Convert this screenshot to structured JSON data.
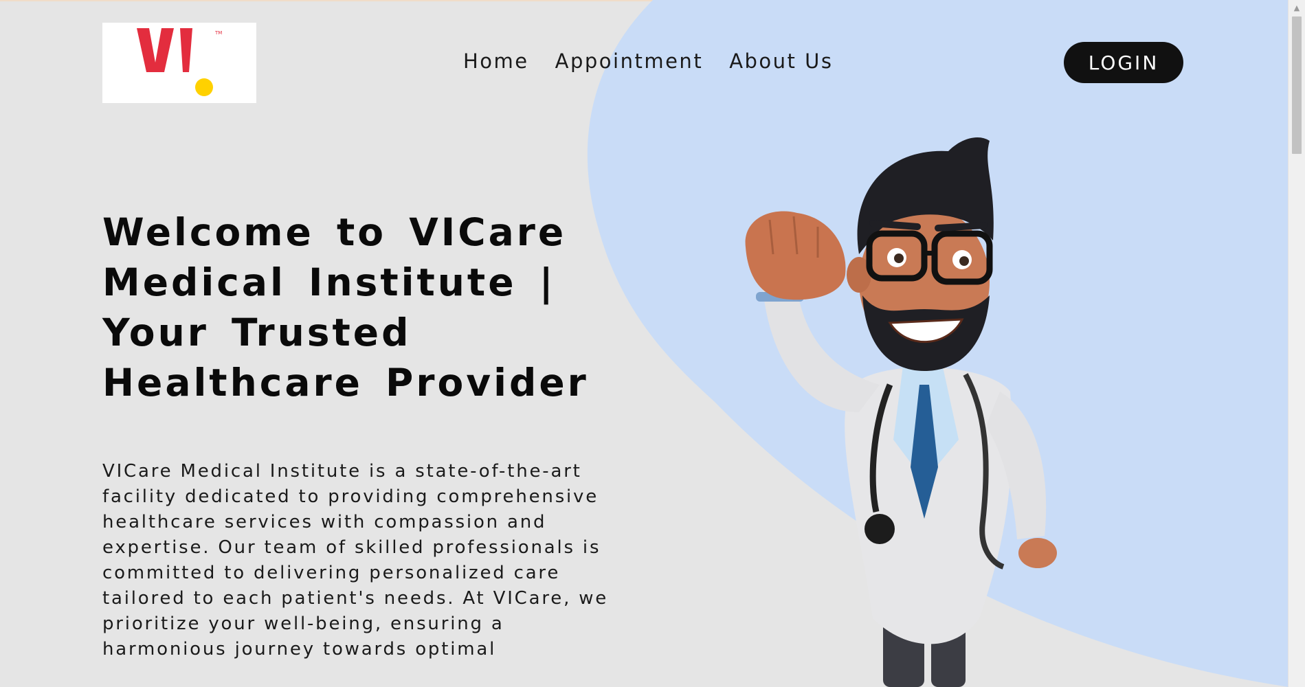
{
  "brand": {
    "logo_text": "VI",
    "trademark": "TM",
    "logo_red": "#e32d3e",
    "logo_yellow": "#ffd100"
  },
  "nav": {
    "items": [
      "Home",
      "Appointment",
      "About Us"
    ],
    "login_label": "LOGIN"
  },
  "hero": {
    "title": "Welcome to VICare Medical Institute | Your Trusted Healthcare Provider",
    "description": "VICare Medical Institute is a state-of-the-art facility dedicated to providing comprehensive healthcare services with compassion and expertise. Our team of skilled professionals is committed to delivering personalized care tailored to each patient's needs. At VICare, we prioritize your well-being, ensuring a harmonious journey towards optimal",
    "illustration": "doctor-illustration"
  },
  "colors": {
    "background": "#e5e5e5",
    "accent_blob": "#c9dcf7",
    "button": "#111111",
    "text": "#0a0a0a"
  }
}
